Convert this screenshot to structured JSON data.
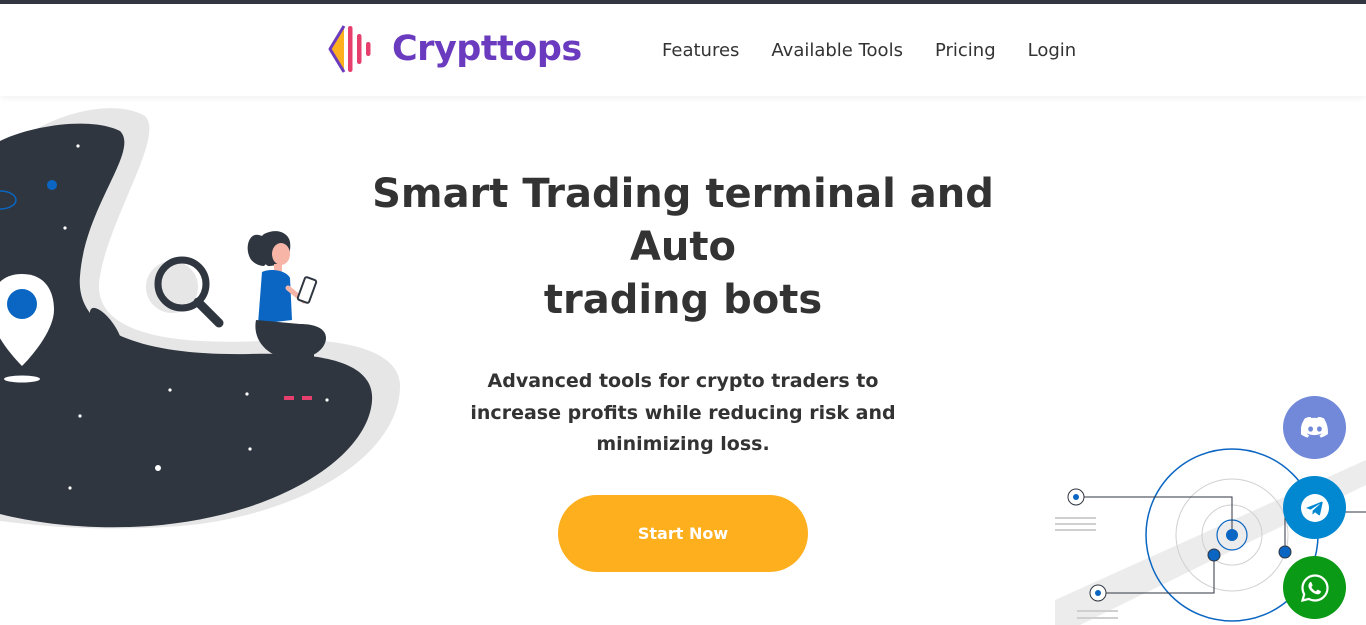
{
  "brand": {
    "name": "Crypttops",
    "colors": {
      "primary": "#6a3bbf",
      "accent": "#fdaf1e",
      "dark": "#2f3640",
      "blue": "#0a66c2"
    }
  },
  "nav": {
    "items": [
      {
        "label": "Features"
      },
      {
        "label": "Available Tools"
      },
      {
        "label": "Pricing"
      },
      {
        "label": "Login"
      }
    ]
  },
  "hero": {
    "title_line1": "Smart Trading terminal and Auto",
    "title_line2": "trading bots",
    "subtitle_line1": "Advanced tools for crypto traders to",
    "subtitle_line2": "increase profits while reducing risk and",
    "subtitle_line3": "minimizing loss.",
    "cta_label": "Start Now"
  },
  "social": {
    "discord": {
      "icon": "discord-icon",
      "color": "#7289da"
    },
    "telegram": {
      "icon": "telegram-icon",
      "color": "#0288d1"
    },
    "whatsapp": {
      "icon": "whatsapp-icon",
      "color": "#0b9a15"
    }
  }
}
